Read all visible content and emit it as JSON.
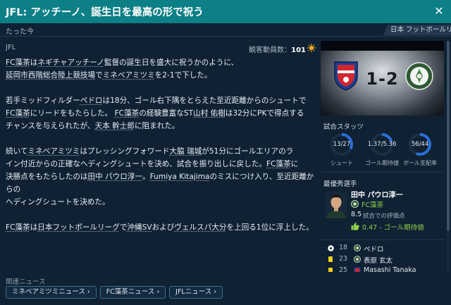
{
  "header": {
    "title": "JFL: アッチーノ、誕生日を最高の形で祝う",
    "close_glyph": "✕"
  },
  "subbar": {
    "time_ago": "たった今",
    "league_tag": "日本 フットボールリーグ"
  },
  "meta": {
    "league": "JFL",
    "attendance_label": "観客動員数：",
    "attendance_value": "101"
  },
  "article": {
    "p1": {
      "t0": "FC藻茶",
      "t1": "は",
      "t2": "ネギチャ",
      "t3": "",
      "t4": "アッチーノ",
      "t5": "監督の誕生日を盛大に祝うかのように、",
      "t6": "延岡市西階総合陸上競技場",
      "t7": "で",
      "t8": "ミネベアミツミ",
      "t9": "を2-1で下した。"
    },
    "p2": {
      "t0": "若手ミッドフィルダー",
      "t1": "ペドロ",
      "t2": "は18分、ゴール右下隅をとらえた至近距離からのシュートで",
      "t3": "FC藻茶",
      "t4": "にリードをもたらした。",
      "t5": "FC藻茶",
      "t6": "の経験豊富なST",
      "t7": "山村 佑樹",
      "t8": "は32分にPKで得点する",
      "t9": "チャンスを与えられたが、",
      "t10": "天本 幹士郎",
      "t11": "に阻まれた。"
    },
    "p3": {
      "t0": "続いて",
      "t1": "ミネベアミツミ",
      "t2": "はプレッシングフォワード",
      "t3": "大脇 瑞城",
      "t4": "が51分にゴールエリアのラ",
      "t5": "イン付近からの正確なヘディングシュートを決め、試合を振り出しに戻した。",
      "t6": "FC藻茶",
      "t7": "に",
      "t8": "決勝点をもたらしたのは",
      "t9": "田中 パウロ淳一",
      "t10": "。",
      "t11": "Fumiya Kitajima",
      "t12": "のミスにつけ入り、至近距離からの",
      "t13": "ヘディングシュートを決めた。"
    },
    "p4": {
      "t0": "FC藻茶",
      "t1": "は",
      "t2": "日本フットボールリーグ",
      "t3": "で",
      "t4": "沖縄SV",
      "t5": "および",
      "t6": "ヴェルスパ大分",
      "t7": "を上回る1位に浮上した。"
    }
  },
  "related": {
    "label": "関連ニュース",
    "chips": [
      "ミネベアミツミニュース",
      "FC藻茶ニュース",
      "JFLニュース"
    ],
    "chevron": "›"
  },
  "score": {
    "text": "1-2"
  },
  "stats": {
    "title": "試合スタッツ",
    "items": [
      {
        "value": "13/27",
        "label": "シュート",
        "home": 13,
        "away": 27
      },
      {
        "value": "1.37/5.36",
        "label": "ゴール期待値",
        "home": 1.37,
        "away": 5.36
      },
      {
        "value": "56/44",
        "label": "ボール支配率",
        "home": 56,
        "away": 44
      }
    ],
    "color_home": "#2b6fd6",
    "color_away": "#2b6fd6"
  },
  "potm": {
    "title": "最優秀選手",
    "name": "田中 パウロ淳一",
    "team": "FC藻茶",
    "rating": "8.5",
    "rating_label": "試合での評価点",
    "xg": "0.47 - ゴール期待値"
  },
  "events": [
    {
      "minute": "18",
      "name": "ペドロ",
      "icon": "goal-ball-icon"
    },
    {
      "minute": "23",
      "name": "表原 玄太",
      "icon": "yellow-card-icon"
    },
    {
      "minute": "25",
      "name": "Masashi Tanaka",
      "icon": "yellow-card-icon"
    }
  ]
}
